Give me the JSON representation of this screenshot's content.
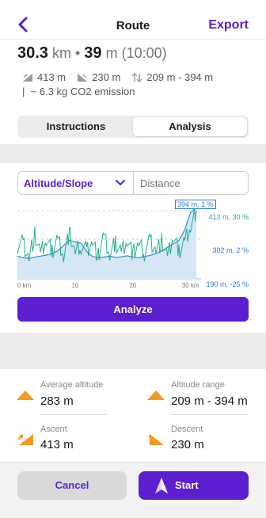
{
  "nav": {
    "back_icon": "chevron-left-icon",
    "title": "Route",
    "export_label": "Export"
  },
  "summary": {
    "distance_value": "30.3",
    "distance_unit": "km",
    "separator": "•",
    "duration_value": "39",
    "duration_unit": "m",
    "duration_clock": "(10:00)"
  },
  "stats": {
    "ascent": "413 m",
    "descent": "230 m",
    "range": "209 m - 394 m",
    "co2_prefix": "|",
    "co2": "~ 6.3 kg CO2 emission"
  },
  "tabs": [
    {
      "label": "Instructions",
      "active": false
    },
    {
      "label": "Analysis",
      "active": true
    }
  ],
  "analysis": {
    "mode_select": "Altitude/Slope",
    "axis_select": "Distance",
    "analyze_label": "Analyze"
  },
  "chart_data": {
    "type": "line",
    "x_ticks": [
      "0 km",
      "10",
      "20",
      "30 km"
    ],
    "xlim": [
      0,
      31
    ],
    "tags": {
      "top": "394 m, 1 %",
      "upper": "413 m, 30 %",
      "middle": "302 m, 2 %",
      "bottom": "190 m, -25 %"
    },
    "colors": {
      "altitude": "#3a86d8",
      "altitude_fill": "#d6e6f7",
      "slope": "#22b08a",
      "tag_blue": "#2b7bd3",
      "tag_green": "#18a77a"
    },
    "series": [
      {
        "values_x": [
          0,
          1,
          2,
          3,
          4,
          5,
          6,
          7,
          8,
          9,
          10,
          11,
          12,
          13,
          14,
          15,
          16,
          17,
          18,
          19,
          20,
          21,
          22,
          23,
          24,
          25,
          26,
          27,
          28,
          29,
          30,
          31
        ],
        "values": [
          255,
          250,
          248,
          252,
          255,
          258,
          262,
          270,
          285,
          300,
          296,
          292,
          268,
          254,
          250,
          252,
          255,
          251,
          253,
          256,
          252,
          250,
          254,
          257,
          262,
          270,
          280,
          290,
          300,
          330,
          380,
          394
        ]
      },
      {
        "values_x": [
          0,
          1,
          2,
          3,
          4,
          5,
          6,
          7,
          8,
          9,
          10,
          11,
          12,
          13,
          14,
          15,
          16,
          17,
          18,
          19,
          20,
          21,
          22,
          23,
          24,
          25,
          26,
          27,
          28,
          29,
          30,
          31
        ],
        "values": [
          2,
          4,
          -8,
          10,
          -5,
          6,
          -3,
          8,
          -6,
          12,
          -4,
          2,
          -2,
          5,
          -7,
          9,
          -6,
          4,
          -3,
          7,
          -5,
          3,
          -4,
          6,
          -2,
          5,
          -8,
          9,
          -3,
          6,
          18,
          30
        ]
      }
    ]
  },
  "stat_cards": {
    "avg_altitude_label": "Average altitude",
    "avg_altitude_value": "283 m",
    "altitude_range_label": "Altitude range",
    "altitude_range_value": "209 m - 394 m",
    "ascent_label": "Ascent",
    "ascent_value": "413 m",
    "descent_label": "Descent",
    "descent_value": "230 m"
  },
  "footer": {
    "cancel_label": "Cancel",
    "start_label": "Start",
    "start_icon": "navigation-arrow-icon"
  },
  "colors": {
    "accent": "#5b1fd0",
    "orange": "#f39a1e"
  }
}
